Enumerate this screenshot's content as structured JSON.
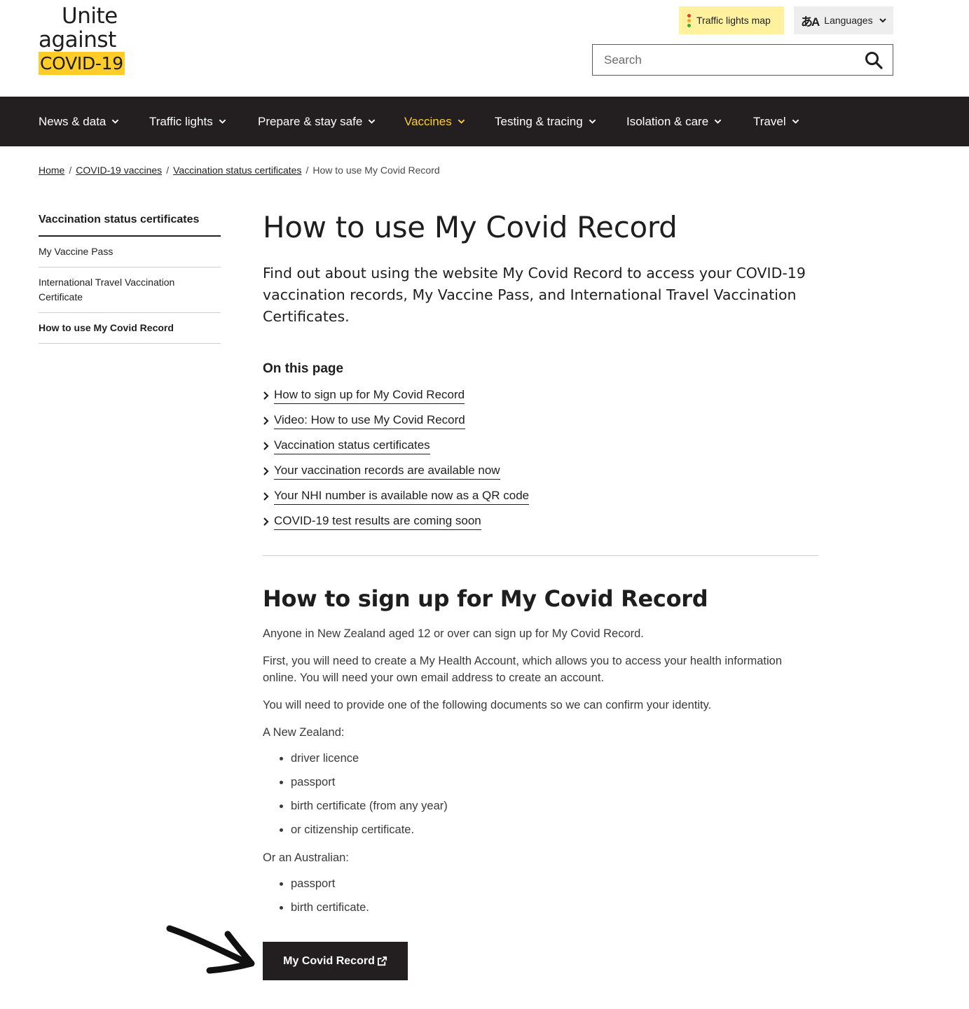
{
  "logo": {
    "line1": "Unite",
    "line2": "against",
    "line3": "COVID-19"
  },
  "header": {
    "traffic_lights_label": "Traffic lights map",
    "traffic_dot_colors": [
      "#e03b24",
      "#f5a623",
      "#3aaa35"
    ],
    "languages_label": "Languages",
    "search_placeholder": "Search"
  },
  "nav": {
    "items": [
      {
        "label": "News & data"
      },
      {
        "label": "Traffic lights"
      },
      {
        "label": "Prepare & stay safe"
      },
      {
        "label": "Vaccines"
      },
      {
        "label": "Testing & tracing"
      },
      {
        "label": "Isolation & care"
      },
      {
        "label": "Travel"
      }
    ],
    "active_color": "#ffcc29"
  },
  "breadcrumb": {
    "items": [
      "Home",
      "COVID-19 vaccines",
      "Vaccination status certificates"
    ],
    "current": "How to use My Covid Record"
  },
  "sidebar": {
    "title": "Vaccination status certificates",
    "items": [
      {
        "label": "My Vaccine Pass"
      },
      {
        "label": "International Travel Vaccination Certificate"
      },
      {
        "label": "How to use My Covid Record"
      }
    ]
  },
  "main": {
    "title": "How to use My Covid Record",
    "intro": "Find out about using the website My Covid Record to access your COVID-19 vaccination records, My Vaccine Pass, and International Travel Vaccination Certificates.",
    "on_this_page_title": "On this page",
    "on_this_page_links": [
      "How to sign up for My Covid Record",
      "Video: How to use My Covid Record",
      "Vaccination status certificates",
      "Your vaccination records are available now",
      "Your NHI number is available now as a QR code",
      "COVID-19 test results are coming soon"
    ],
    "section_title": "How to sign up for My Covid Record",
    "p1": "Anyone in New Zealand aged 12 or over can sign up for My Covid Record.",
    "p2": "First, you will need to create a My Health Account, which allows you to access your health information online. You will need your own email address to create an account.",
    "p3": "You will need to provide one of the following documents so we can confirm your identity.",
    "p4": "A New Zealand:",
    "nz_docs": [
      "driver licence",
      "passport",
      "birth certificate (from any year)",
      "or citizenship certificate."
    ],
    "p5": "Or an Australian:",
    "au_docs": [
      "passport",
      "birth certificate."
    ],
    "button_label": "My Covid Record"
  }
}
